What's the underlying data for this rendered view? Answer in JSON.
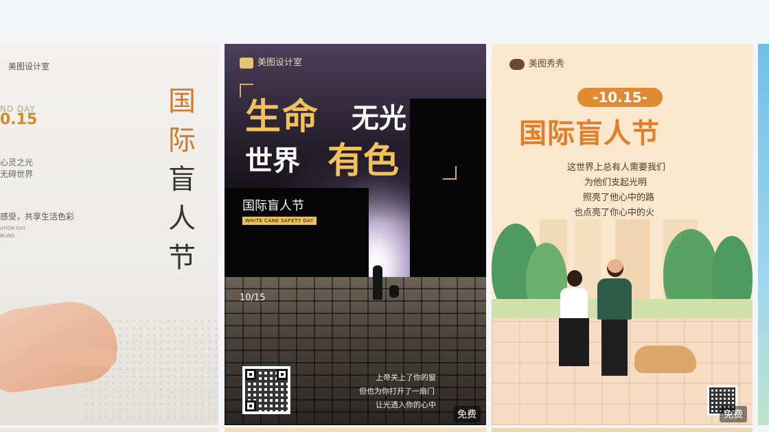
{
  "cards": [
    {
      "id": "card1",
      "brand": "美图设计室",
      "band_text": "ND DAY",
      "date": "0.15",
      "line1": "心灵之光",
      "line2": "无碍世界",
      "line3": "感受，共享生活色彩",
      "eng1": "ATION DAY",
      "eng2": "BLIND",
      "vertical_title": [
        "国",
        "际",
        "盲",
        "人",
        "节"
      ],
      "vertical_colors": [
        "#d07a2d",
        "#d07a2d",
        "#333333",
        "#333333",
        "#333333"
      ]
    },
    {
      "id": "card2",
      "brand": "美图设计室",
      "headline1_gold": "生命",
      "headline1_white": "无光",
      "headline2_white": "世界",
      "headline2_gold": "有色",
      "festival": "国际盲人节",
      "english": "WHITE CANE SAFETY DAY",
      "date": "10/15",
      "poem": [
        "上帝关上了你的窗",
        "但也为你打开了一扇门",
        "让光透入你的心中"
      ],
      "badge": "免费"
    },
    {
      "id": "card3",
      "brand": "美图秀秀",
      "date_pill": "-10.15-",
      "title": "国际盲人节",
      "lines": [
        "这世界上总有人需要我们",
        "为他们支起光明",
        "照亮了他心中的路",
        "也点亮了你心中的火"
      ],
      "badge": "免费"
    }
  ],
  "colors": {
    "background": "#f4f5f8",
    "gold": "#f0c15c",
    "orange": "#e07e2a"
  }
}
